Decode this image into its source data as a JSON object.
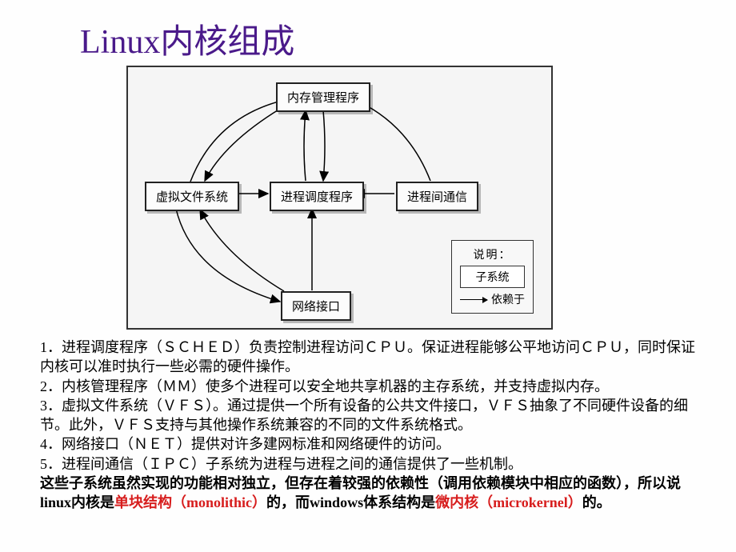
{
  "title": "Linux内核组成",
  "diagram": {
    "nodes": {
      "mm": "内存管理程序",
      "vfs": "虚拟文件系统",
      "sched": "进程调度程序",
      "ipc": "进程间通信",
      "net": "网络接口"
    },
    "legend": {
      "title": "说明：",
      "subsystem": "子系统",
      "depends": "依赖于"
    },
    "edges": [
      {
        "from": "vfs",
        "to": "mm",
        "bidir": true
      },
      {
        "from": "sched",
        "to": "mm",
        "bidir": true
      },
      {
        "from": "ipc",
        "to": "mm",
        "bidir": false
      },
      {
        "from": "vfs",
        "to": "sched",
        "bidir": false
      },
      {
        "from": "ipc",
        "to": "sched",
        "bidir": false
      },
      {
        "from": "net",
        "to": "sched",
        "bidir": false
      },
      {
        "from": "vfs",
        "to": "net",
        "bidir": true
      }
    ]
  },
  "items": {
    "i1": "1．进程调度程序（ＳＣＨＥＤ）负责控制进程访问ＣＰＵ。保证进程能够公平地访问ＣＰＵ，同时保证内核可以准时执行一些必需的硬件操作。",
    "i2": "2．内核管理程序（ＭＭ）使多个进程可以安全地共享机器的主存系统，并支持虚拟内存。",
    "i3": "3．虚拟文件系统（ＶＦＳ）。通过提供一个所有设备的公共文件接口，ＶＦＳ抽象了不同硬件设备的细节。此外，ＶＦＳ支持与其他操作系统兼容的不同的文件系统格式。",
    "i4": "4．网络接口（ＮＥＴ）提供对许多建网标准和网络硬件的访问。",
    "i5": "5．进程间通信（ＩＰＣ）子系统为进程与进程之间的通信提供了一些机制。"
  },
  "conclusion": {
    "p1": "这些子系统虽然实现的功能相对独立，但存在着较强的依赖性（调用依赖模块中相应的函数），所以说linux内核是",
    "r1": "单块结构（monolithic）",
    "p2": "的，而windows体系结构是",
    "r2": "微内核（microkernel）",
    "p3": "的。"
  }
}
